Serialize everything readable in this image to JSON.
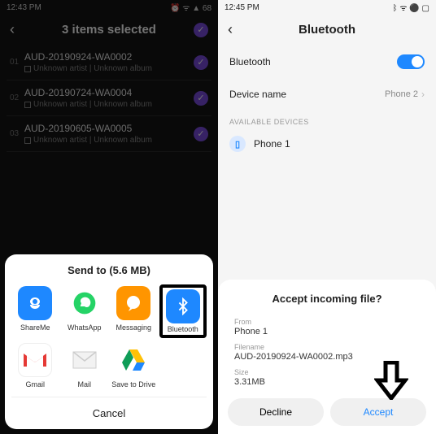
{
  "left": {
    "status": {
      "time": "12:43 PM",
      "icons": "⏰ ᯤ ▲ 68"
    },
    "header": {
      "title": "3 items selected"
    },
    "tracks": [
      {
        "num": "01",
        "name": "AUD-20190924-WA0002",
        "sub": "Unknown artist | Unknown album"
      },
      {
        "num": "02",
        "name": "AUD-20190724-WA0004",
        "sub": "Unknown artist | Unknown album"
      },
      {
        "num": "03",
        "name": "AUD-20190605-WA0005",
        "sub": "Unknown artist | Unknown album"
      }
    ],
    "sheet": {
      "title": "Send to (5.6 MB)",
      "apps": [
        {
          "label": "ShareMe"
        },
        {
          "label": "WhatsApp"
        },
        {
          "label": "Messaging"
        },
        {
          "label": "Bluetooth"
        },
        {
          "label": "Gmail"
        },
        {
          "label": "Mail"
        },
        {
          "label": "Save to Drive"
        }
      ],
      "cancel": "Cancel"
    }
  },
  "right": {
    "status": {
      "time": "12:45 PM",
      "icons": "ᛒ ᯤ ⚫ ▢"
    },
    "header": {
      "title": "Bluetooth"
    },
    "rows": {
      "bt_label": "Bluetooth",
      "devname_label": "Device name",
      "devname_value": "Phone 2"
    },
    "section": "AVAILABLE DEVICES",
    "device": "Phone 1",
    "incoming": {
      "title": "Accept incoming file?",
      "from_label": "From",
      "from_value": "Phone 1",
      "file_label": "Filename",
      "file_value": "AUD-20190924-WA0002.mp3",
      "size_label": "Size",
      "size_value": "3.31MB",
      "decline": "Decline",
      "accept": "Accept"
    }
  }
}
